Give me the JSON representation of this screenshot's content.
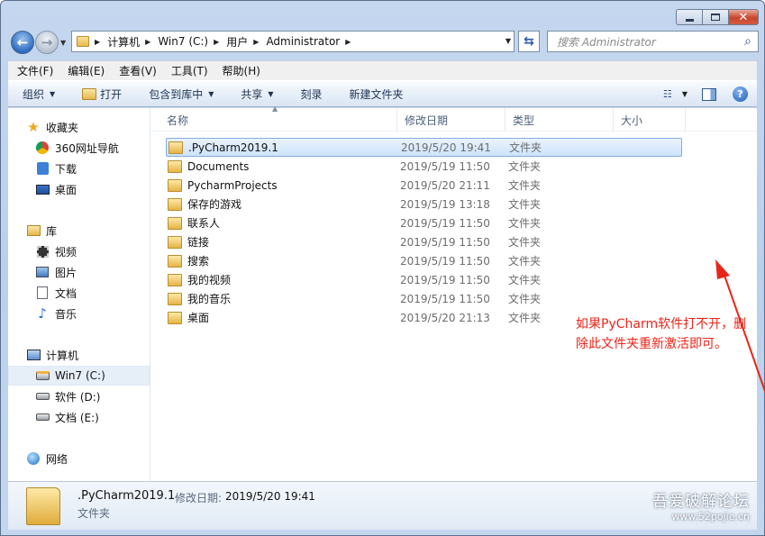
{
  "window": {
    "caption": {
      "minimize": "minimize",
      "maximize": "maximize",
      "close": "close"
    }
  },
  "address": {
    "crumbs": [
      "计算机",
      "Win7 (C:)",
      "用户",
      "Administrator"
    ]
  },
  "search": {
    "placeholder": "搜索 Administrator"
  },
  "menu": [
    "文件(F)",
    "编辑(E)",
    "查看(V)",
    "工具(T)",
    "帮助(H)"
  ],
  "commands": {
    "organize": "组织",
    "open": "打开",
    "include": "包含到库中",
    "share": "共享",
    "burn": "刻录",
    "new_folder": "新建文件夹"
  },
  "navpane": {
    "favorites": "收藏夹",
    "fav_items": [
      "360网址导航",
      "下载",
      "桌面"
    ],
    "libraries": "库",
    "lib_items": [
      "视频",
      "图片",
      "文档",
      "音乐"
    ],
    "computer": "计算机",
    "drives": [
      "Win7 (C:)",
      "软件 (D:)",
      "文档 (E:)"
    ],
    "network": "网络"
  },
  "columns": {
    "name": "名称",
    "date": "修改日期",
    "type": "类型",
    "size": "大小"
  },
  "files": [
    {
      "name": ".PyCharm2019.1",
      "date": "2019/5/20 19:41",
      "type": "文件夹",
      "selected": true
    },
    {
      "name": "Documents",
      "date": "2019/5/19 11:50",
      "type": "文件夹"
    },
    {
      "name": "PycharmProjects",
      "date": "2019/5/20 21:11",
      "type": "文件夹"
    },
    {
      "name": "保存的游戏",
      "date": "2019/5/19 13:18",
      "type": "文件夹"
    },
    {
      "name": "联系人",
      "date": "2019/5/19 11:50",
      "type": "文件夹"
    },
    {
      "name": "链接",
      "date": "2019/5/19 11:50",
      "type": "文件夹"
    },
    {
      "name": "搜索",
      "date": "2019/5/19 11:50",
      "type": "文件夹"
    },
    {
      "name": "我的视频",
      "date": "2019/5/19 11:50",
      "type": "文件夹"
    },
    {
      "name": "我的音乐",
      "date": "2019/5/19 11:50",
      "type": "文件夹"
    },
    {
      "name": "桌面",
      "date": "2019/5/20 21:13",
      "type": "文件夹"
    }
  ],
  "annotation": {
    "line1": "如果PyCharm软件打不开，删",
    "line2": "除此文件夹重新激活即可。",
    "color": "#e8251a"
  },
  "details": {
    "name": ".PyCharm2019.1",
    "date_label": "修改日期:",
    "date_value": "2019/5/20 19:41",
    "type": "文件夹"
  },
  "watermark": {
    "line1": "吾爱破解论坛",
    "line2": "www.52pojie.cn"
  }
}
